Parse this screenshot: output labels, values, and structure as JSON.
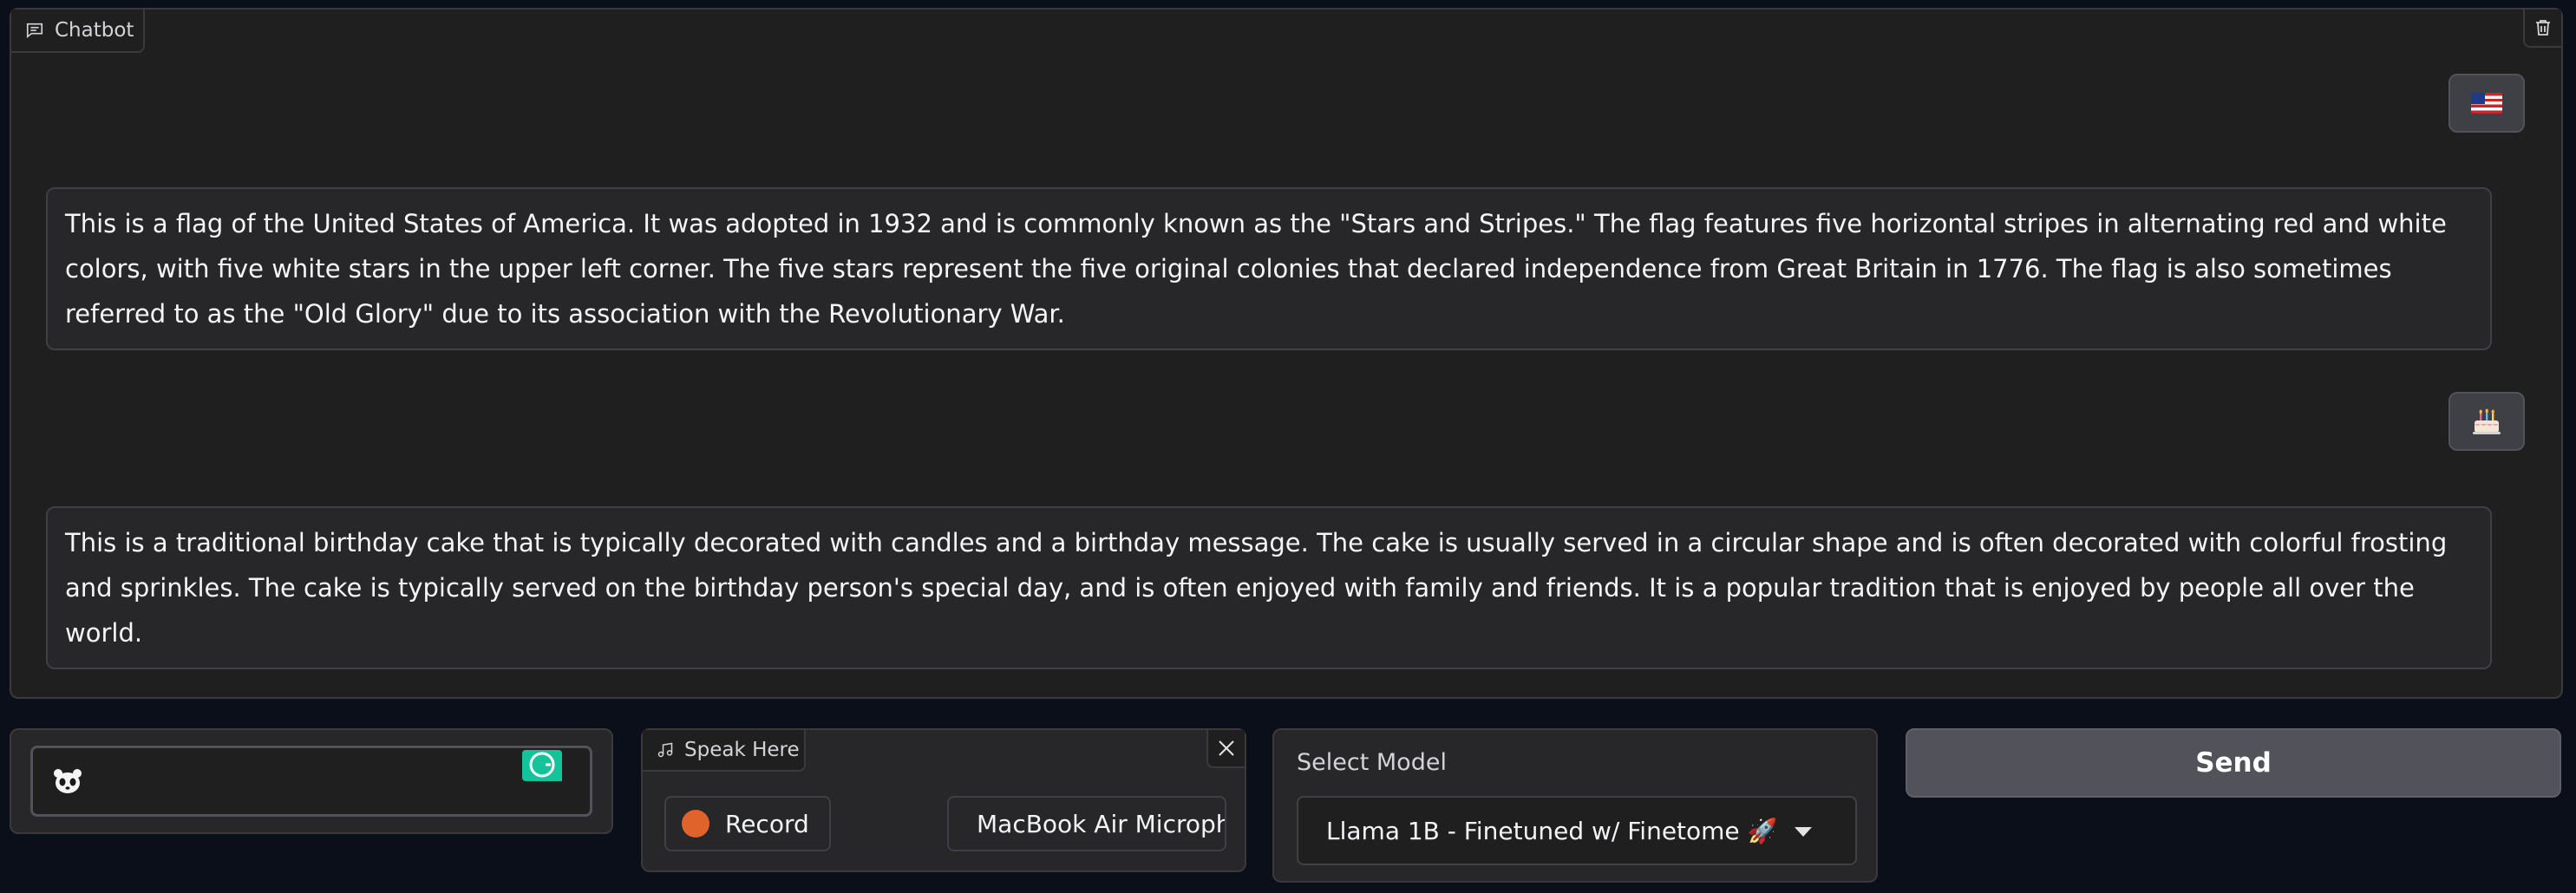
{
  "chatbot": {
    "label": "Chatbot",
    "messages": [
      {
        "role": "user",
        "attachment": "us-flag-icon"
      },
      {
        "role": "assistant",
        "text": "This is a flag of the United States of America. It was adopted in 1932 and is commonly known as the \"Stars and Stripes.\" The flag features five horizontal stripes in alternating red and white colors, with five white stars in the upper left corner. The five stars represent the five original colonies that declared independence from Great Britain in 1776. The flag is also sometimes referred to as the \"Old Glory\" due to its association with the Revolutionary War."
      },
      {
        "role": "user",
        "attachment": "birthday-cake-icon"
      },
      {
        "role": "assistant",
        "text": "This is a traditional birthday cake that is typically decorated with candles and a birthday message. The cake is usually served in a circular shape and is often decorated with colorful frosting and sprinkles. The cake is typically served on the birthday person's special day, and is often enjoyed with family and friends. It is a popular tradition that is enjoyed by people all over the world."
      }
    ]
  },
  "input": {
    "value": "",
    "emoji_icon": "panda-icon",
    "extension_icon": "grammarly-icon"
  },
  "audio": {
    "label": "Speak Here",
    "record_label": "Record",
    "microphone": "MacBook Air Microphone"
  },
  "model": {
    "title": "Select Model",
    "selected": "Llama 1B - Finetuned w/ Finetome 🚀"
  },
  "send": {
    "label": "Send"
  },
  "colors": {
    "background": "#0b0f19",
    "panel": "#1f1f1f",
    "record_dot": "#e0632c",
    "send_button": "#52525b"
  }
}
